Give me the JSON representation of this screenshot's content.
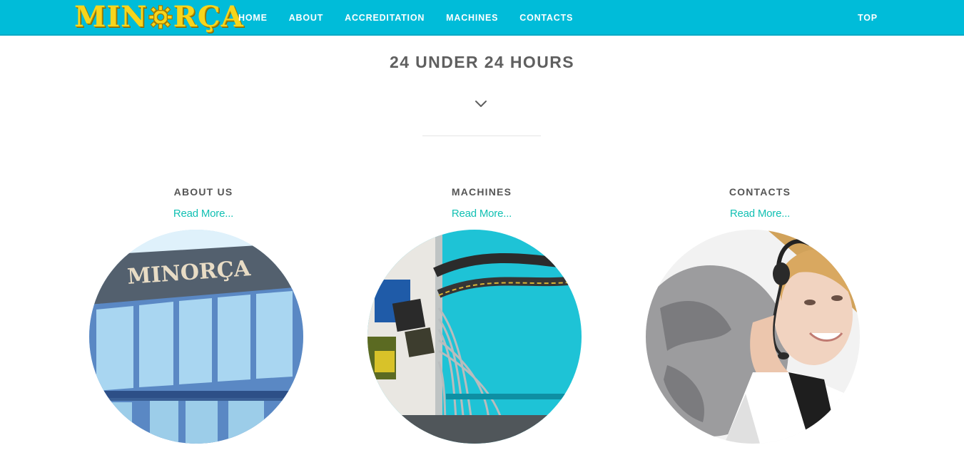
{
  "header": {
    "logo_text_left": "MIN",
    "logo_text_right": "RÇA",
    "nav": [
      "HOME",
      "ABOUT",
      "ACCREDITATION",
      "MACHINES",
      "CONTACTS"
    ],
    "top_label": "TOP",
    "bar_color": "#00bcd9",
    "logo_color": "#f7d51c"
  },
  "hero": {
    "headline": "24 UNDER 24 HOURS",
    "chevron_icon": "chevron-down-icon"
  },
  "cards": [
    {
      "title": "ABOUT US",
      "link": "Read More...",
      "image": "building-facade-image"
    },
    {
      "title": "MACHINES",
      "link": "Read More...",
      "image": "machine-wiring-image"
    },
    {
      "title": "CONTACTS",
      "link": "Read More...",
      "image": "support-operator-image"
    }
  ],
  "building_sign": "MINORÇA",
  "accent_color": "#12c0b3"
}
